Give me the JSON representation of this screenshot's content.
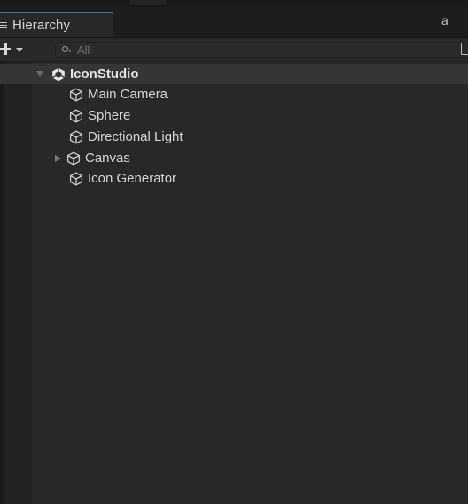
{
  "window": {
    "tab_title": "Hierarchy",
    "menu_icon": "tab-menu-icon",
    "lock_icon": "lock-icon",
    "lock_glyph": "a",
    "more_glyph": "⋮"
  },
  "toolbar": {
    "add_icon": "plus-icon",
    "search_placeholder": "All",
    "search_value": ""
  },
  "hierarchy": {
    "scene": {
      "name": "IconStudio",
      "expanded": true,
      "icon": "unity-scene-icon"
    },
    "items": [
      {
        "label": "Main Camera",
        "icon": "gameobject-cube-icon",
        "has_children": false
      },
      {
        "label": "Sphere",
        "icon": "gameobject-cube-icon",
        "has_children": false
      },
      {
        "label": "Directional Light",
        "icon": "gameobject-cube-icon",
        "has_children": false
      },
      {
        "label": "Canvas",
        "icon": "gameobject-cube-icon",
        "has_children": true,
        "expanded": false
      },
      {
        "label": "Icon Generator",
        "icon": "gameobject-cube-icon",
        "has_children": false
      }
    ]
  },
  "colors": {
    "panel_bg": "#282828",
    "accent": "#3a79bb",
    "selected_row": "#353535",
    "text": "#d6d6d6"
  }
}
